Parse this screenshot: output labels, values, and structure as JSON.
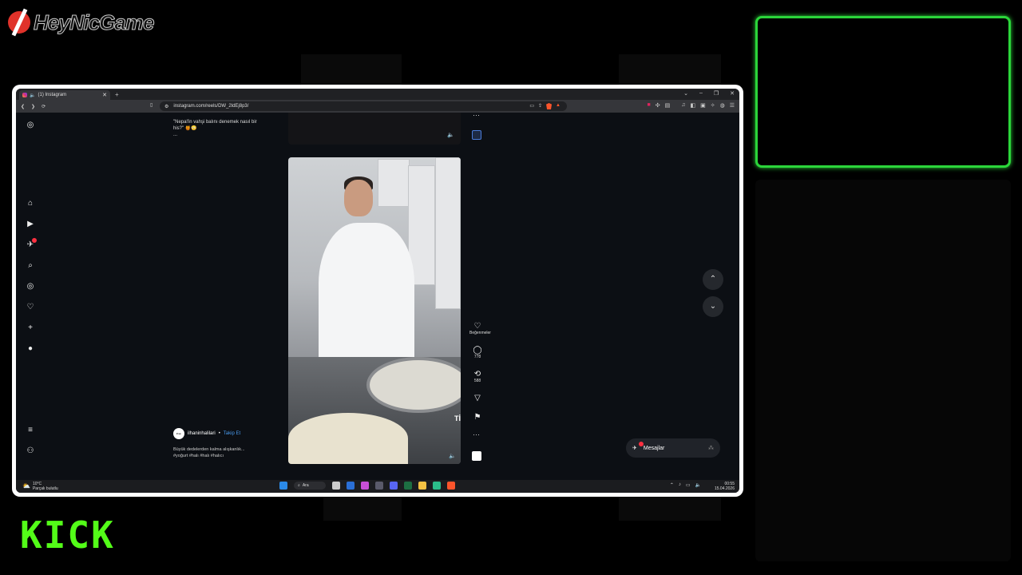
{
  "overlay": {
    "brand_text": "HeyNicGame",
    "platform": "KICK",
    "accent_color": "#53fc18"
  },
  "browser": {
    "tab_title": "(1) Instagram",
    "new_tab": "+",
    "url": "instagram.com/reels/DW_2ldEj8p3/"
  },
  "instagram": {
    "prev_caption_line1": "\"Nepal'in vahşi balını denemek nasıl bir",
    "prev_caption_line2": "his?\" 🍯😳",
    "prev_caption_more": "...",
    "author": "ilhaninhalilari",
    "follow_label": "Takip Et",
    "separator": "•",
    "caption_line1": "Büyük dedelerden kalma alışkanlık...",
    "caption_line2": "#yoğurt #halı #halı #halıcı",
    "likes_label": "Beğenmeler",
    "comments_count": "778",
    "reposts_count": "588",
    "messages_label": "Mesajlar",
    "notification_count": "1",
    "overlay_text_right": "Tİ"
  },
  "taskbar": {
    "temperature": "10°C",
    "weather_desc": "Parçalı bulutlu",
    "search_label": "Ara",
    "time": "00:55",
    "date": "15.04.2026"
  }
}
